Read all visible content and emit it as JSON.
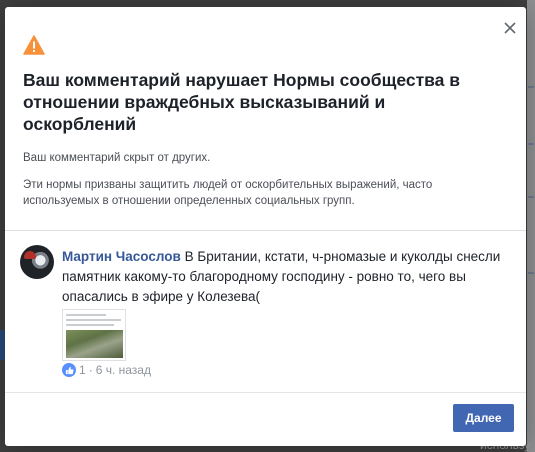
{
  "background": {
    "bottom_right_text": "использу"
  },
  "modal": {
    "title": "Ваш комментарий нарушает Нормы сообщества в отношении враждебных высказываний и оскорблений",
    "hidden_notice": "Ваш комментарий скрыт от других.",
    "description": "Эти нормы призваны защитить людей от оскорбительных выражений, часто используемых в отношении определенных социальных групп.",
    "comment": {
      "author": "Мартин Часослов",
      "text": " В Британии, кстати, ч-рномазые и куколды снесли памятник какому-то благородному господину - ровно то, чего вы опасались в эфире у Колезева(",
      "like_count": "1",
      "separator": " · ",
      "time": "6 ч. назад"
    },
    "next_button_label": "Далее"
  },
  "colors": {
    "accent": "#4267b2",
    "link": "#365899",
    "warning": "#f7923b",
    "like": "#5890ff"
  },
  "icons": {
    "warning": "warning-triangle-icon",
    "close": "close-icon",
    "like": "like-icon"
  }
}
